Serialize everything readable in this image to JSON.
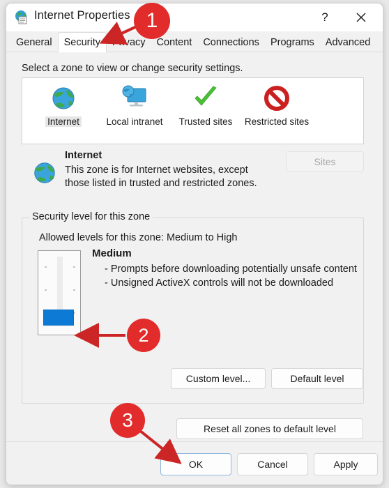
{
  "window": {
    "title": "Internet Properties",
    "icon": "internet-properties-icon",
    "help_label": "?",
    "close_label": "✕"
  },
  "tabs": [
    {
      "label": "General",
      "active": false
    },
    {
      "label": "Security",
      "active": true
    },
    {
      "label": "Privacy",
      "active": false
    },
    {
      "label": "Content",
      "active": false
    },
    {
      "label": "Connections",
      "active": false
    },
    {
      "label": "Programs",
      "active": false
    },
    {
      "label": "Advanced",
      "active": false
    }
  ],
  "security": {
    "select_zone_label": "Select a zone to view or change security settings.",
    "zones": [
      {
        "label": "Internet",
        "icon": "globe-icon",
        "selected": true
      },
      {
        "label": "Local intranet",
        "icon": "monitor-globe-icon",
        "selected": false
      },
      {
        "label": "Trusted sites",
        "icon": "green-check-icon",
        "selected": false
      },
      {
        "label": "Restricted sites",
        "icon": "red-prohibition-icon",
        "selected": false
      }
    ],
    "zone_detail": {
      "icon": "globe-icon",
      "title": "Internet",
      "description": "This zone is for Internet websites, except those listed in trusted and restricted zones.",
      "sites_button": "Sites",
      "sites_button_disabled": true
    },
    "level_group": {
      "title": "Security level for this zone",
      "allowed_levels": "Allowed levels for this zone: Medium to High",
      "level_name": "Medium",
      "level_bullets": [
        "- Prompts before downloading potentially unsafe content",
        "- Unsigned ActiveX controls will not be downloaded"
      ],
      "slider_position": "bottom",
      "slider_thumb_color": "#0d7ad6",
      "custom_level_button": "Custom level...",
      "default_level_button": "Default level"
    },
    "reset_button": "Reset all zones to default level"
  },
  "footer": {
    "ok": "OK",
    "cancel": "Cancel",
    "apply": "Apply"
  },
  "annotations": {
    "accent_color": "#e22b2b",
    "markers": [
      {
        "number": "1",
        "target": "security-tab"
      },
      {
        "number": "2",
        "target": "security-level-slider"
      },
      {
        "number": "3",
        "target": "ok-button"
      }
    ]
  }
}
